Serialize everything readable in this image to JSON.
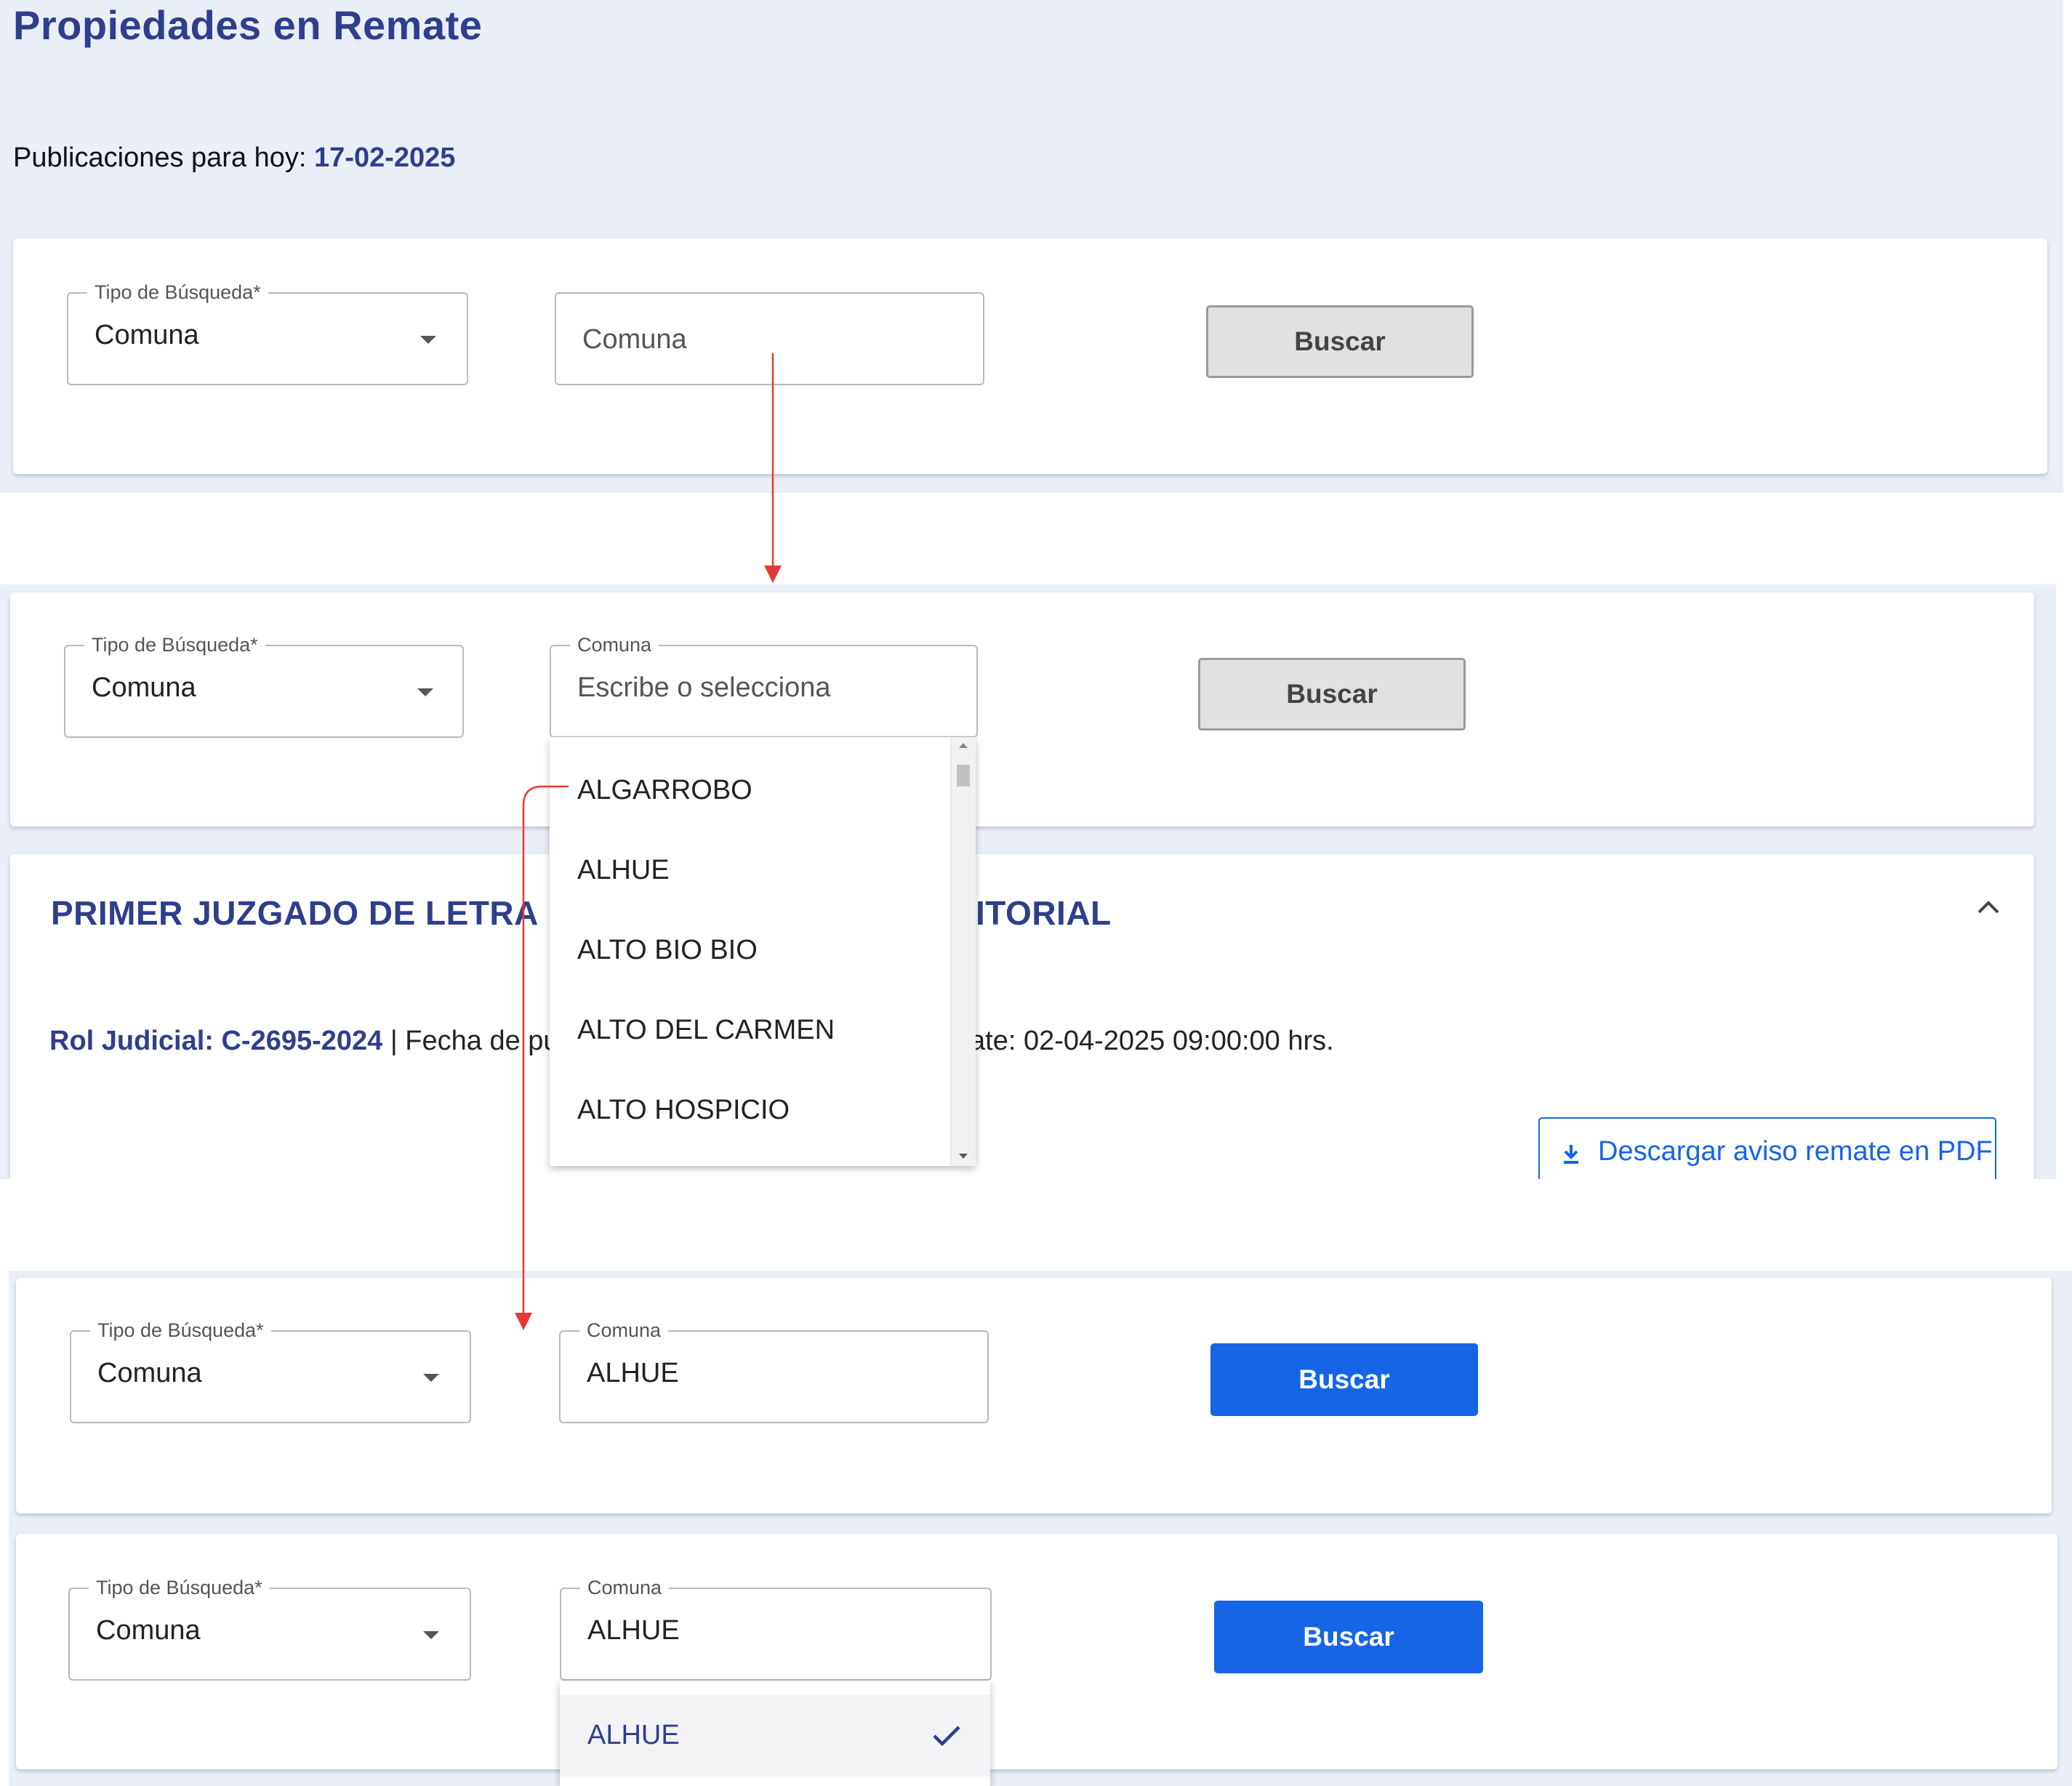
{
  "page": {
    "title": "Propiedades en Remate",
    "publications_label": "Publicaciones para hoy:",
    "publications_date": "17-02-2025"
  },
  "step1": {
    "search_type": {
      "label": "Tipo de Búsqueda*",
      "value": "Comuna"
    },
    "comuna_input": {
      "placeholder": "Comuna"
    },
    "search_button": "Buscar"
  },
  "step2": {
    "search_type": {
      "label": "Tipo de Búsqueda*",
      "value": "Comuna"
    },
    "comuna_input": {
      "label": "Comuna",
      "placeholder": "Escribe o selecciona"
    },
    "search_button": "Buscar",
    "dropdown_options": [
      "ALGARROBO",
      "ALHUE",
      "ALTO BIO BIO",
      "ALTO DEL CARMEN",
      "ALTO HOSPICIO"
    ],
    "result": {
      "court_title_left": "PRIMER JUZGADO DE LETRA",
      "court_title_right": "ITORIAL",
      "rol_label": "Rol Judicial: C-2695-2024",
      "rol_text_left": " | Fecha de publ",
      "rol_text_right": "ate: 02-04-2025 09:00:00 hrs.",
      "pdf_button": "Descargar aviso remate en PDF"
    }
  },
  "step3": {
    "search_type": {
      "label": "Tipo de Búsqueda*",
      "value": "Comuna"
    },
    "comuna_input": {
      "label": "Comuna",
      "value": "ALHUE"
    },
    "search_button": "Buscar"
  },
  "step4": {
    "search_type": {
      "label": "Tipo de Búsqueda*",
      "value": "Comuna"
    },
    "comuna_input": {
      "label": "Comuna",
      "value": "ALHUE"
    },
    "search_button": "Buscar",
    "selected_option": "ALHUE"
  },
  "colors": {
    "brand_navy": "#2f3e8c",
    "primary_blue": "#1565e6",
    "annotation_arrow": "#e53935",
    "page_background": "#e9eef7"
  },
  "icons": [
    "chevron-down-icon",
    "chevron-up-icon",
    "download-icon",
    "check-icon",
    "arrow-annotation"
  ]
}
